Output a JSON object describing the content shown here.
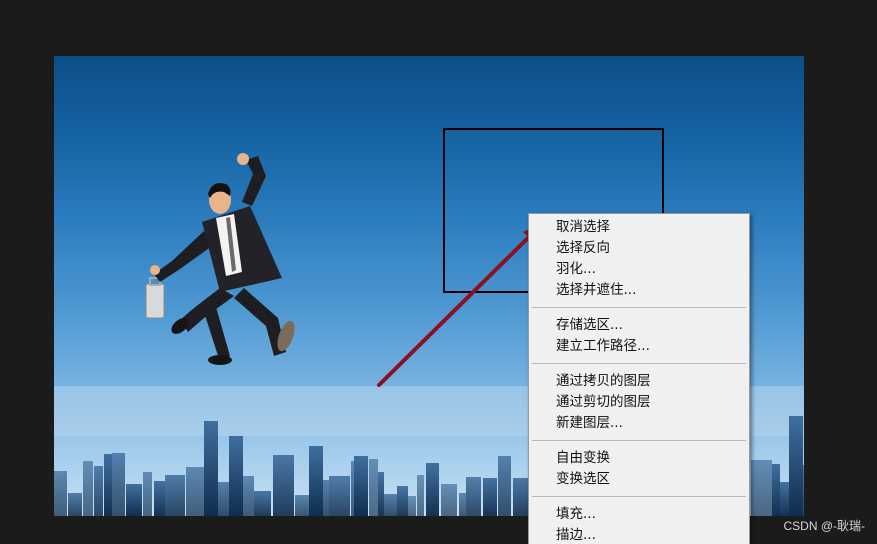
{
  "menu": {
    "groups": [
      [
        "取消选择",
        "选择反向",
        "羽化...",
        "选择并遮住..."
      ],
      [
        "存储选区...",
        "建立工作路径..."
      ],
      [
        "通过拷贝的图层",
        "通过剪切的图层",
        "新建图层..."
      ],
      [
        "自由变换",
        "变换选区"
      ],
      [
        "填充...",
        "描边..."
      ]
    ]
  },
  "watermark": "CSDN @-耿瑞-",
  "colors": {
    "app_background": "#1b1b1b",
    "menu_background": "#f0f0f0",
    "arrow": "#8b1020",
    "sky_top": "#0d4e88",
    "sky_bottom": "#c9e0f2"
  },
  "icons": {
    "selection": "marquee-selection",
    "arrow": "annotation-arrow"
  }
}
